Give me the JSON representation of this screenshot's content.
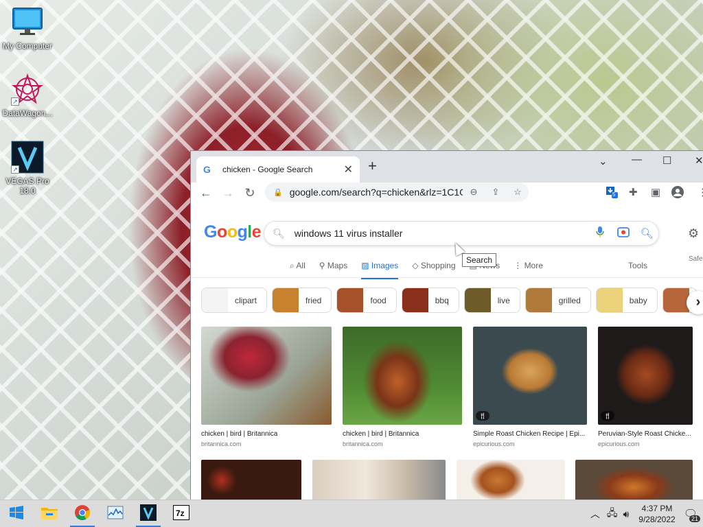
{
  "desktop": {
    "icons": [
      {
        "label": "My Computer",
        "icon": "monitor-icon"
      },
      {
        "label": "DataWagon...",
        "icon": "datawagon-icon"
      },
      {
        "label": "VEGAS Pro 18.0",
        "icon": "vegas-pro-icon"
      }
    ]
  },
  "browser": {
    "tab_title": "chicken - Google Search",
    "new_tab_symbol": "+",
    "url": "google.com/search?q=chicken&rlz=1C1GCEU_enUS99...",
    "extension_badge": "5"
  },
  "google": {
    "logo_text": "Google",
    "query": "windows 11 virus installer",
    "tooltip": "Search",
    "nav_tabs": [
      {
        "label": "All",
        "icon": "search-icon",
        "active": false
      },
      {
        "label": "Maps",
        "icon": "map-pin-icon",
        "active": false
      },
      {
        "label": "Images",
        "icon": "image-icon",
        "active": true
      },
      {
        "label": "Shopping",
        "icon": "tag-icon",
        "active": false
      },
      {
        "label": "News",
        "icon": "news-icon",
        "active": false
      },
      {
        "label": "More",
        "icon": "more-icon",
        "active": false
      }
    ],
    "tools_label": "Tools",
    "safe_label": "Safe",
    "chips": [
      "clipart",
      "fried",
      "food",
      "bbq",
      "live",
      "grilled",
      "baby",
      ""
    ],
    "results": [
      {
        "caption": "chicken | bird | Britannica",
        "source": "britannica.com",
        "recipe_badge": false
      },
      {
        "caption": "chicken | bird | Britannica",
        "source": "britannica.com",
        "recipe_badge": false
      },
      {
        "caption": "Simple Roast Chicken Recipe | Epi...",
        "source": "epicurious.com",
        "recipe_badge": true
      },
      {
        "caption": "Peruvian-Style Roast Chicke...",
        "source": "epicurious.com",
        "recipe_badge": true
      }
    ]
  },
  "taskbar": {
    "apps": [
      {
        "name": "start",
        "icon": "windows-start-icon"
      },
      {
        "name": "file-explorer",
        "icon": "folder-icon"
      },
      {
        "name": "chrome",
        "icon": "chrome-icon"
      },
      {
        "name": "task-manager",
        "icon": "performance-graph-icon"
      },
      {
        "name": "vegas-pro",
        "icon": "vegas-pro-icon"
      },
      {
        "name": "7-zip",
        "icon": "7zip-icon"
      }
    ],
    "time": "4:37 PM",
    "date": "9/28/2022",
    "notification_count": "21"
  },
  "colors": {
    "google_blue": "#4285f4",
    "google_red": "#ea4335",
    "google_yellow": "#fbbc05",
    "google_green": "#34a853",
    "active_tab": "#1a73e8"
  }
}
